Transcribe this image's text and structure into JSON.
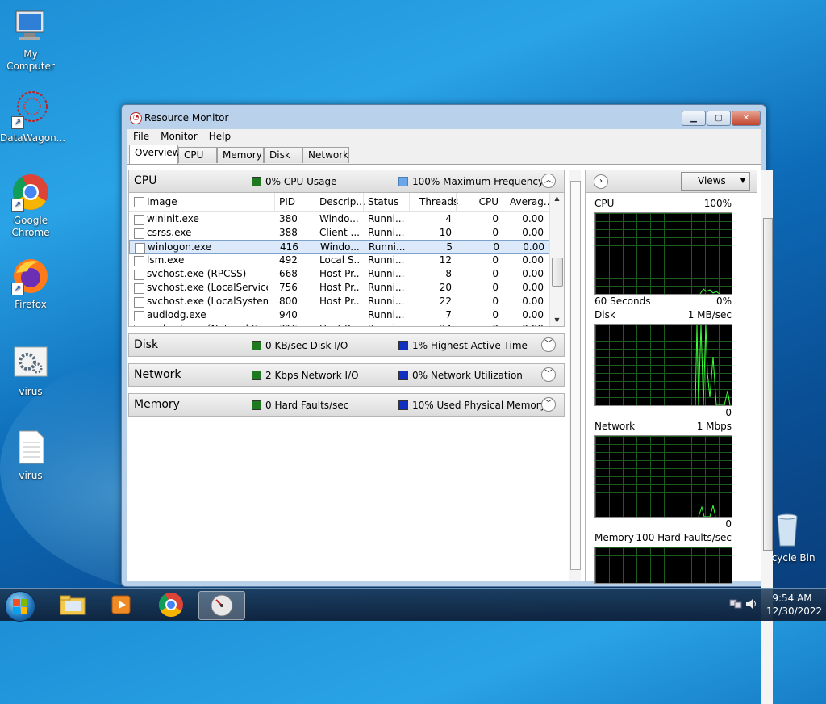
{
  "desktop": {
    "icons": [
      {
        "label": "My Computer"
      },
      {
        "label": "DataWagon..."
      },
      {
        "label": "Google Chrome"
      },
      {
        "label": "Firefox"
      },
      {
        "label": "virus"
      },
      {
        "label": "virus"
      },
      {
        "label": "Recycle Bin"
      }
    ]
  },
  "window": {
    "title": "Resource Monitor",
    "menu": [
      "File",
      "Monitor",
      "Help"
    ],
    "tabs": [
      "Overview",
      "CPU",
      "Memory",
      "Disk",
      "Network"
    ],
    "active_tab": "Overview"
  },
  "cpu": {
    "name": "CPU",
    "legend1": "0% CPU Usage",
    "legend2": "100% Maximum Frequency",
    "columns": [
      "Image",
      "PID",
      "Descrip...",
      "Status",
      "Threads",
      "CPU",
      "Averag..."
    ],
    "rows": [
      {
        "image": "wininit.exe",
        "pid": "380",
        "desc": "Windo...",
        "status": "Runni...",
        "threads": "4",
        "cpu": "0",
        "avg": "0.00"
      },
      {
        "image": "csrss.exe",
        "pid": "388",
        "desc": "Client ...",
        "status": "Runni...",
        "threads": "10",
        "cpu": "0",
        "avg": "0.00"
      },
      {
        "image": "winlogon.exe",
        "pid": "416",
        "desc": "Windo...",
        "status": "Runni...",
        "threads": "5",
        "cpu": "0",
        "avg": "0.00"
      },
      {
        "image": "lsm.exe",
        "pid": "492",
        "desc": "Local S...",
        "status": "Runni...",
        "threads": "12",
        "cpu": "0",
        "avg": "0.00"
      },
      {
        "image": "svchost.exe (RPCSS)",
        "pid": "668",
        "desc": "Host Pr...",
        "status": "Runni...",
        "threads": "8",
        "cpu": "0",
        "avg": "0.00"
      },
      {
        "image": "svchost.exe (LocalServiceNet...",
        "pid": "756",
        "desc": "Host Pr...",
        "status": "Runni...",
        "threads": "20",
        "cpu": "0",
        "avg": "0.00"
      },
      {
        "image": "svchost.exe (LocalSystemNet...",
        "pid": "800",
        "desc": "Host Pr...",
        "status": "Runni...",
        "threads": "22",
        "cpu": "0",
        "avg": "0.00"
      },
      {
        "image": "audiodg.exe",
        "pid": "940",
        "desc": "",
        "status": "Runni...",
        "threads": "7",
        "cpu": "0",
        "avg": "0.00"
      },
      {
        "image": "svchost.exe (NetworkService)",
        "pid": "316",
        "desc": "Host Pr...",
        "status": "Runni...",
        "threads": "24",
        "cpu": "0",
        "avg": "0.00"
      }
    ]
  },
  "disk": {
    "name": "Disk",
    "legend1": "0 KB/sec Disk I/O",
    "legend2": "1% Highest Active Time"
  },
  "network": {
    "name": "Network",
    "legend1": "2 Kbps Network I/O",
    "legend2": "0% Network Utilization"
  },
  "memory": {
    "name": "Memory",
    "legend1": "0 Hard Faults/sec",
    "legend2": "10% Used Physical Memory"
  },
  "graphs": {
    "views_label": "Views",
    "cpu": {
      "label": "CPU",
      "max": "100%",
      "time": "60 Seconds",
      "min": "0%"
    },
    "disk": {
      "label": "Disk",
      "max": "1 MB/sec",
      "min": "0"
    },
    "network": {
      "label": "Network",
      "max": "1 Mbps",
      "min": "0"
    },
    "memory": {
      "label": "Memory",
      "max": "100 Hard Faults/sec"
    }
  },
  "taskbar": {
    "time": "9:54 AM",
    "date": "12/30/2022"
  },
  "colors": {
    "legend_green": "#1f7a1f",
    "legend_blue": "#1030c0",
    "legend_lightblue": "#6aa6e8",
    "graph_line": "#3cff3c"
  }
}
